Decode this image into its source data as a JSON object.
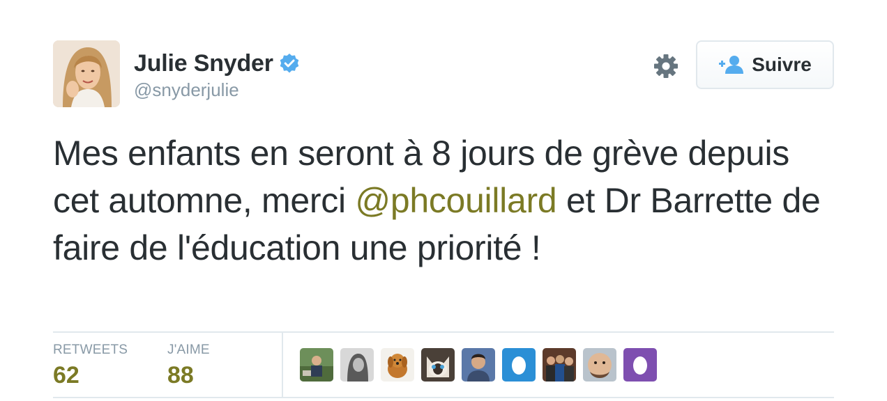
{
  "user": {
    "name": "Julie Snyder",
    "handle": "@snyderjulie",
    "verified": true
  },
  "actions": {
    "follow_label": "Suivre",
    "settings_icon": "gear-icon",
    "follow_icon": "add-user-icon"
  },
  "tweet": {
    "text_before": "Mes enfants en seront à 8 jours de grève depuis cet automne, merci ",
    "mention": "@phcouillard",
    "text_after": " et Dr Barrette de faire de l'éducation une priorité !"
  },
  "stats": {
    "retweets_label": "RETWEETS",
    "retweets_value": "62",
    "likes_label": "J'AIME",
    "likes_value": "88"
  },
  "likers": [
    {
      "icon": "user-photo-outdoor"
    },
    {
      "icon": "user-photo-grayscale"
    },
    {
      "icon": "user-photo-dog"
    },
    {
      "icon": "user-photo-cat"
    },
    {
      "icon": "user-photo-man"
    },
    {
      "icon": "default-egg-blue"
    },
    {
      "icon": "user-photo-group"
    },
    {
      "icon": "user-photo-face"
    },
    {
      "icon": "default-egg-purple"
    }
  ],
  "colors": {
    "text": "#292f33",
    "muted": "#8899a6",
    "link": "#7b7a25",
    "verified": "#55acee",
    "border": "#e1e8ed",
    "egg_blue": "#2b8fd6",
    "egg_purple": "#7e4fb0"
  }
}
